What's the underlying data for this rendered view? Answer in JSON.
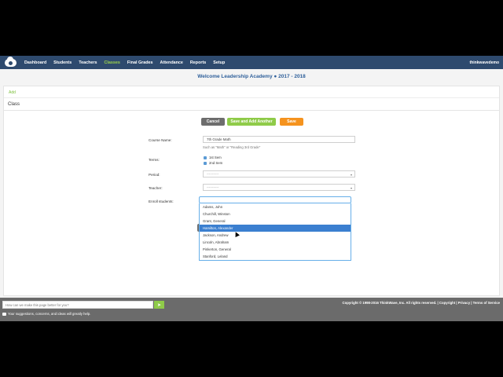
{
  "nav": {
    "items": [
      "Dashboard",
      "Students",
      "Teachers",
      "Classes",
      "Final Grades",
      "Attendance",
      "Reports",
      "Setup"
    ],
    "active": "Classes",
    "user": "thinkwavedemo"
  },
  "header": {
    "school": "Welcome Leadership Academy  ● 2017 - 2018"
  },
  "breadcrumb": {
    "label": "Add"
  },
  "page": {
    "title": "Class"
  },
  "buttons": {
    "cancel": "Cancel",
    "save_add": "Save and Add Another",
    "save": "Save"
  },
  "form": {
    "course_label": "Course Name:",
    "course_value": "7th Grade Math",
    "course_hint": "Such as \"Math\" or \"Reading 3rd Grade\"",
    "terms_label": "Terms:",
    "terms": [
      "1st Sem",
      "2nd Sem"
    ],
    "period_label": "Period:",
    "period_value": "-----------",
    "teacher_label": "Teacher:",
    "teacher_value": "-----------",
    "enroll_label": "Enroll students:",
    "students": [
      "Adams, John",
      "Churchill, Winston",
      "Grant, General",
      "Hamilton, Alexander",
      "Jackson, Andrew",
      "Lincoln, Abraham",
      "Pinkerton, General",
      "Stanford, Leland"
    ],
    "highlighted": "Hamilton, Alexander"
  },
  "footer": {
    "feedback_placeholder": "How can we make this page better for you?",
    "note": "Your suggestions, concerns, and ideas will greatly help.",
    "copyright": "Copyright © 1998-2016 ThinkWave, Inc. All rights reserved. | Copyright | Privacy | Terms of Service"
  },
  "colors": {
    "navbar": "#2e4a6e",
    "accent_green": "#8fcb49",
    "save_orange": "#f5931e",
    "highlight": "#3b7fd0"
  }
}
